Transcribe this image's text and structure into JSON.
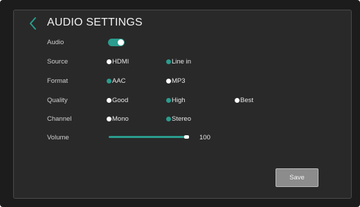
{
  "title": "AUDIO SETTINGS",
  "icons": {
    "back": "chevron-left-icon"
  },
  "colors": {
    "accent": "#2a9d8f",
    "background": "#292929",
    "save_button": "#8c8c8c"
  },
  "audio": {
    "label": "Audio",
    "enabled": true
  },
  "source": {
    "label": "Source",
    "options": [
      {
        "label": "HDMI",
        "selected": false
      },
      {
        "label": "Line in",
        "selected": true
      }
    ]
  },
  "format": {
    "label": "Format",
    "options": [
      {
        "label": "AAC",
        "selected": true
      },
      {
        "label": "MP3",
        "selected": false
      }
    ]
  },
  "quality": {
    "label": "Quality",
    "options": [
      {
        "label": "Good",
        "selected": false
      },
      {
        "label": "High",
        "selected": true
      },
      {
        "label": "Best",
        "selected": false
      }
    ]
  },
  "channel": {
    "label": "Channel",
    "options": [
      {
        "label": "Mono",
        "selected": false
      },
      {
        "label": "Stereo",
        "selected": true
      }
    ]
  },
  "volume": {
    "label": "Volume",
    "value": "100",
    "max": 100
  },
  "save_label": "Save"
}
